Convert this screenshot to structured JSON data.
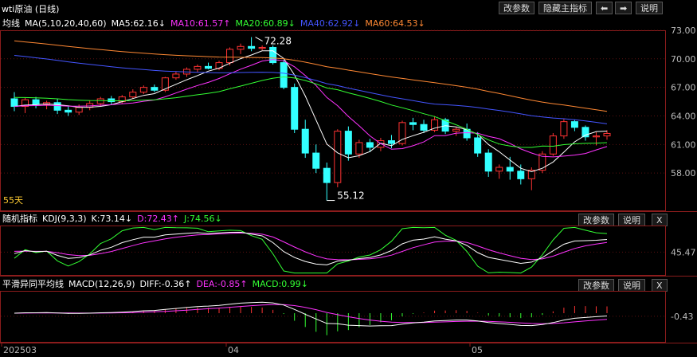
{
  "window": {
    "title": "wti原油 (日线)",
    "buttons": {
      "change_params": "改参数",
      "hide_main": "隐藏主指标",
      "left_arrow": "⬅",
      "right_arrow": "➡",
      "help": "说明"
    }
  },
  "main_legend": {
    "label": "均线",
    "ma_def": "MA(5,10,20,40,60)",
    "ma5": "MA5:62.16↓",
    "ma10": "MA10:61.57↑",
    "ma20": "MA20:60.89↓",
    "ma40": "MA40:62.92↓",
    "ma60": "MA60:64.53↓",
    "colors": {
      "ma5": "#ffffff",
      "ma10": "#ff33ff",
      "ma20": "#33ff33",
      "ma40": "#4455ff",
      "ma60": "#ff8833"
    }
  },
  "main_annotations": {
    "high": "72.28",
    "low": "55.12",
    "days": "55天"
  },
  "main_axis": [
    "73.00",
    "70.00",
    "67.00",
    "64.00",
    "61.00",
    "58.00"
  ],
  "kdj_panel": {
    "label": "随机指标",
    "def": "KDJ(9,3,3)",
    "k": "K:73.14↓",
    "d": "D:72.43↑",
    "j": "J:74.56↓",
    "axis": "45.47",
    "btn_change": "改参数",
    "btn_help": "说明",
    "btn_close": "X"
  },
  "macd_panel": {
    "label": "平滑异同平均线",
    "def": "MACD(12,26,9)",
    "diff": "DIFF:-0.36↑",
    "dea": "DEA:-0.85↑",
    "macd": "MACD:0.99↓",
    "axis": "-0.43",
    "btn_change": "改参数",
    "btn_help": "说明",
    "btn_close": "X"
  },
  "x_axis": [
    "202503",
    "04",
    "05"
  ],
  "chart_data": {
    "type": "candlestick",
    "candles": [
      [
        65.8,
        66.5,
        64.5,
        65.0
      ],
      [
        65.0,
        65.9,
        64.3,
        65.7
      ],
      [
        65.7,
        66.0,
        64.8,
        65.2
      ],
      [
        65.2,
        65.6,
        64.7,
        65.4
      ],
      [
        65.4,
        65.8,
        64.2,
        64.6
      ],
      [
        64.6,
        65.0,
        64.0,
        64.4
      ],
      [
        64.4,
        65.2,
        64.1,
        64.9
      ],
      [
        64.9,
        65.6,
        64.6,
        65.3
      ],
      [
        65.3,
        66.0,
        65.0,
        65.8
      ],
      [
        65.8,
        66.1,
        65.2,
        65.5
      ],
      [
        65.5,
        66.2,
        65.3,
        66.0
      ],
      [
        66.0,
        66.8,
        65.8,
        66.5
      ],
      [
        66.5,
        67.2,
        66.3,
        67.0
      ],
      [
        67.0,
        67.3,
        66.5,
        66.7
      ],
      [
        66.7,
        68.1,
        66.5,
        68.0
      ],
      [
        68.0,
        68.7,
        67.8,
        68.4
      ],
      [
        68.4,
        69.1,
        68.1,
        68.9
      ],
      [
        68.9,
        69.4,
        68.6,
        69.2
      ],
      [
        69.2,
        69.6,
        68.9,
        69.0
      ],
      [
        69.0,
        69.8,
        68.8,
        69.6
      ],
      [
        69.6,
        71.2,
        69.3,
        71.0
      ],
      [
        71.0,
        71.6,
        70.5,
        71.3
      ],
      [
        71.3,
        72.28,
        70.8,
        71.1
      ],
      [
        71.1,
        71.4,
        70.9,
        71.2
      ],
      [
        71.2,
        71.4,
        69.4,
        69.6
      ],
      [
        69.6,
        69.9,
        66.8,
        67.0
      ],
      [
        67.0,
        67.4,
        62.2,
        62.6
      ],
      [
        62.6,
        63.6,
        59.6,
        60.1
      ],
      [
        60.1,
        61.0,
        58.0,
        58.5
      ],
      [
        58.5,
        59.1,
        55.12,
        57.0
      ],
      [
        57.0,
        62.6,
        56.5,
        62.4
      ],
      [
        62.4,
        62.9,
        59.3,
        60.0
      ],
      [
        60.0,
        61.5,
        59.6,
        61.2
      ],
      [
        61.2,
        61.6,
        60.2,
        60.7
      ],
      [
        60.7,
        61.7,
        60.3,
        61.4
      ],
      [
        61.4,
        62.0,
        60.6,
        61.1
      ],
      [
        61.1,
        63.5,
        60.9,
        63.3
      ],
      [
        63.3,
        63.8,
        62.5,
        63.1
      ],
      [
        63.1,
        63.6,
        62.2,
        62.5
      ],
      [
        62.5,
        63.9,
        62.3,
        63.6
      ],
      [
        63.6,
        63.8,
        62.1,
        62.4
      ],
      [
        62.4,
        62.8,
        61.9,
        62.6
      ],
      [
        62.6,
        63.2,
        61.4,
        61.7
      ],
      [
        61.7,
        62.3,
        59.7,
        60.1
      ],
      [
        60.1,
        60.5,
        57.6,
        58.2
      ],
      [
        58.2,
        58.9,
        57.4,
        58.6
      ],
      [
        58.6,
        59.7,
        57.3,
        58.2
      ],
      [
        58.2,
        58.9,
        56.8,
        57.4
      ],
      [
        57.4,
        58.6,
        56.2,
        58.3
      ],
      [
        58.3,
        60.3,
        58.0,
        60.0
      ],
      [
        60.0,
        62.2,
        59.8,
        61.9
      ],
      [
        61.9,
        63.7,
        61.6,
        63.4
      ],
      [
        63.4,
        63.6,
        62.4,
        62.8
      ],
      [
        62.8,
        63.0,
        61.4,
        61.8
      ],
      [
        61.8,
        62.3,
        60.9,
        61.9
      ],
      [
        61.9,
        62.5,
        61.5,
        62.16
      ]
    ]
  }
}
